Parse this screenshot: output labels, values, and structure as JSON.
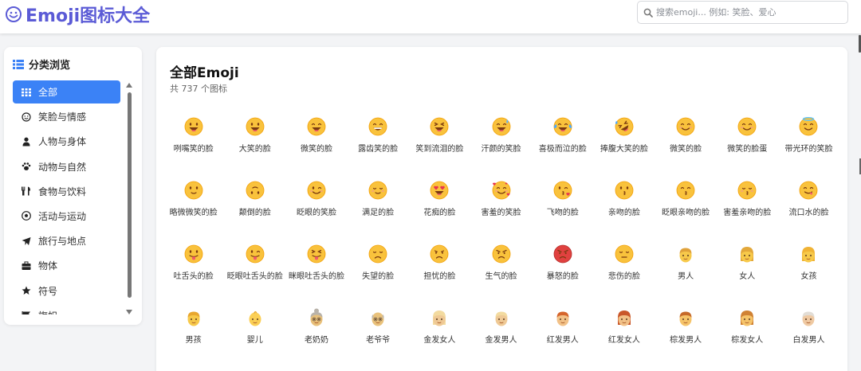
{
  "header": {
    "title": "Emoji图标大全",
    "search_placeholder": "搜索emoji... 例如: 笑脸、爱心",
    "search_value": ""
  },
  "colors": {
    "brand": "#5b5bd6",
    "active": "#3b82f6",
    "face": "#fbbf24"
  },
  "sidebar": {
    "title": "分类浏览",
    "items": [
      {
        "label": "全部",
        "icon": "grid-icon",
        "active": true
      },
      {
        "label": "笑脸与情感",
        "icon": "smile-icon",
        "active": false
      },
      {
        "label": "人物与身体",
        "icon": "user-icon",
        "active": false
      },
      {
        "label": "动物与自然",
        "icon": "paw-icon",
        "active": false
      },
      {
        "label": "食物与饮料",
        "icon": "utensils-icon",
        "active": false
      },
      {
        "label": "活动与运动",
        "icon": "soccer-ball-icon",
        "active": false
      },
      {
        "label": "旅行与地点",
        "icon": "plane-icon",
        "active": false
      },
      {
        "label": "物体",
        "icon": "briefcase-icon",
        "active": false
      },
      {
        "label": "符号",
        "icon": "star-icon",
        "active": false
      },
      {
        "label": "旗帜",
        "icon": "flag-icon",
        "active": false
      }
    ]
  },
  "main": {
    "title": "全部Emoji",
    "count_text": "共 737 个图标",
    "emojis": [
      {
        "label": "咧嘴笑的脸",
        "icon": "grinning-face"
      },
      {
        "label": "大笑的脸",
        "icon": "grinning-face-big-eyes"
      },
      {
        "label": "微笑的脸",
        "icon": "grinning-face-smiling-eyes"
      },
      {
        "label": "露齿笑的脸",
        "icon": "beaming-face"
      },
      {
        "label": "笑到流泪的脸",
        "icon": "grinning-squinting-face"
      },
      {
        "label": "汗颜的笑脸",
        "icon": "grinning-face-sweat"
      },
      {
        "label": "喜极而泣的脸",
        "icon": "face-tears-of-joy"
      },
      {
        "label": "捧腹大笑的脸",
        "icon": "rolling-on-floor-laughing"
      },
      {
        "label": "微笑的脸",
        "icon": "smiling-face"
      },
      {
        "label": "微笑的脸蛋",
        "icon": "smiling-face-smiling-eyes"
      },
      {
        "label": "带光环的笑脸",
        "icon": "smiling-face-halo"
      },
      {
        "label": "略微微笑的脸",
        "icon": "slightly-smiling-face"
      },
      {
        "label": "颠倒的脸",
        "icon": "upside-down-face"
      },
      {
        "label": "眨眼的笑脸",
        "icon": "winking-face"
      },
      {
        "label": "满足的脸",
        "icon": "relieved-face"
      },
      {
        "label": "花痴的脸",
        "icon": "heart-eyes-face"
      },
      {
        "label": "害羞的笑脸",
        "icon": "smiling-face-hearts"
      },
      {
        "label": "飞吻的脸",
        "icon": "face-blowing-kiss"
      },
      {
        "label": "亲吻的脸",
        "icon": "kissing-face"
      },
      {
        "label": "眨眼亲吻的脸",
        "icon": "kissing-face-smiling-eyes"
      },
      {
        "label": "害羞亲吻的脸",
        "icon": "kissing-face-closed-eyes"
      },
      {
        "label": "流口水的脸",
        "icon": "face-savoring-food"
      },
      {
        "label": "吐舌头的脸",
        "icon": "face-with-tongue"
      },
      {
        "label": "眨眼吐舌头的脸",
        "icon": "winking-face-tongue"
      },
      {
        "label": "眯眼吐舌头的脸",
        "icon": "squinting-face-tongue"
      },
      {
        "label": "失望的脸",
        "icon": "disappointed-face"
      },
      {
        "label": "担忧的脸",
        "icon": "worried-face"
      },
      {
        "label": "生气的脸",
        "icon": "angry-face"
      },
      {
        "label": "暴怒的脸",
        "icon": "enraged-face"
      },
      {
        "label": "悲伤的脸",
        "icon": "pensive-face"
      },
      {
        "label": "男人",
        "icon": "man"
      },
      {
        "label": "女人",
        "icon": "woman"
      },
      {
        "label": "女孩",
        "icon": "girl"
      },
      {
        "label": "男孩",
        "icon": "boy"
      },
      {
        "label": "婴儿",
        "icon": "baby"
      },
      {
        "label": "老奶奶",
        "icon": "old-woman"
      },
      {
        "label": "老爷爷",
        "icon": "old-man"
      },
      {
        "label": "金发女人",
        "icon": "blond-woman"
      },
      {
        "label": "金发男人",
        "icon": "blond-man"
      },
      {
        "label": "红发男人",
        "icon": "red-haired-man"
      },
      {
        "label": "红发女人",
        "icon": "red-haired-woman"
      },
      {
        "label": "棕发男人",
        "icon": "brown-haired-man"
      },
      {
        "label": "棕发女人",
        "icon": "brown-haired-woman"
      },
      {
        "label": "白发男人",
        "icon": "white-haired-man"
      }
    ]
  }
}
